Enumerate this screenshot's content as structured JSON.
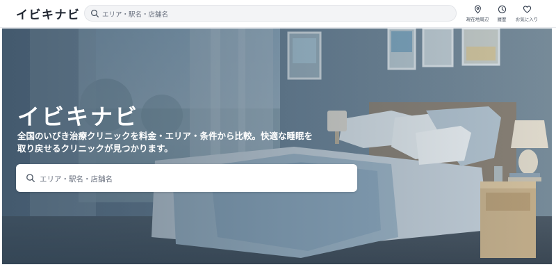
{
  "header": {
    "logo": "イビキナビ",
    "search": {
      "placeholder": "エリア・駅名・店舗名"
    },
    "nav": [
      {
        "label": "現在地周辺",
        "icon": "location-pin-icon"
      },
      {
        "label": "履歴",
        "icon": "clock-icon"
      },
      {
        "label": "お気に入り",
        "icon": "heart-icon"
      }
    ]
  },
  "hero": {
    "title": "イビキナビ",
    "subtitle_lines": [
      "全国のいびき治療クリニックを料金・エリア・条件から比較。快適な睡眠を",
      "取り戻せるクリニックが見つかります。"
    ],
    "search": {
      "placeholder": "エリア・駅名・店舗名",
      "icon": "search-icon"
    },
    "background": "bedroom-photo"
  },
  "colors": {
    "text": "#1f2530",
    "header_bg": "#ffffff",
    "search_bg": "#f3f4f6",
    "hero_overlay": "#3d5468",
    "hero_text": "#ffffff"
  }
}
